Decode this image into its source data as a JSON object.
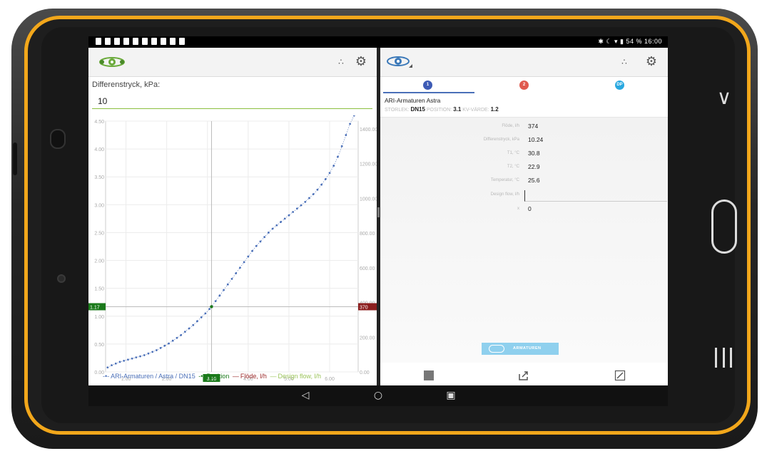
{
  "status_bar": {
    "right_text": "✱ ☾ ▾ ▮ 54 % 16:00"
  },
  "left_pane": {
    "field_label": "Differenstryck, kPa:",
    "field_value": "10",
    "legend": [
      {
        "label": "ARI-Armaturen / Astra / DN15",
        "color": "#4a6fb8"
      },
      {
        "label": "Position",
        "color": "#1b7a1b"
      },
      {
        "label": "Flöde, l/h",
        "color": "#9b2a2a"
      },
      {
        "label": "Design flow, l/h",
        "color": "#9bc45a"
      }
    ]
  },
  "chart_data": {
    "type": "line",
    "x_ticks": [
      "1.00",
      "2.00",
      "3.00",
      "4.00",
      "5.00",
      "6.00"
    ],
    "y_left_ticks": [
      "0.00",
      "0.50",
      "1.00",
      "1.50",
      "2.00",
      "2.50",
      "3.00",
      "3.50",
      "4.00",
      "4.50"
    ],
    "y_right_ticks": [
      "0.00",
      "200.00",
      "400.00",
      "600.00",
      "800.00",
      "1000.00",
      "1200.00",
      "1400.00"
    ],
    "xlim": [
      0.5,
      6.7
    ],
    "ylim_left": [
      0,
      4.5
    ],
    "ylim_right": [
      0,
      1445
    ],
    "grid": true,
    "position_marker": {
      "x_label": "3.10",
      "y_left_label": "1.17",
      "y_right_label": "370",
      "x": 3.1,
      "y": 1.17
    },
    "series": [
      {
        "name": "ARI-Armaturen / Astra / DN15",
        "x": [
          0.55,
          0.65,
          0.75,
          0.85,
          0.95,
          1.05,
          1.15,
          1.25,
          1.35,
          1.45,
          1.55,
          1.65,
          1.75,
          1.85,
          1.95,
          2.05,
          2.15,
          2.25,
          2.35,
          2.45,
          2.55,
          2.65,
          2.75,
          2.85,
          2.95,
          3.05,
          3.1,
          3.2,
          3.3,
          3.4,
          3.5,
          3.6,
          3.7,
          3.8,
          3.9,
          4.0,
          4.1,
          4.2,
          4.3,
          4.4,
          4.5,
          4.6,
          4.7,
          4.8,
          4.9,
          5.0,
          5.1,
          5.2,
          5.3,
          5.4,
          5.5,
          5.6,
          5.7,
          5.8,
          5.9,
          6.0,
          6.1,
          6.2,
          6.3,
          6.4,
          6.5,
          6.6
        ],
        "y": [
          0.08,
          0.12,
          0.15,
          0.18,
          0.2,
          0.22,
          0.24,
          0.26,
          0.28,
          0.3,
          0.33,
          0.36,
          0.39,
          0.43,
          0.47,
          0.51,
          0.56,
          0.61,
          0.66,
          0.72,
          0.78,
          0.84,
          0.91,
          0.98,
          1.05,
          1.13,
          1.17,
          1.27,
          1.37,
          1.47,
          1.57,
          1.67,
          1.77,
          1.87,
          1.97,
          2.07,
          2.17,
          2.26,
          2.34,
          2.42,
          2.5,
          2.57,
          2.63,
          2.69,
          2.75,
          2.81,
          2.87,
          2.93,
          2.99,
          3.05,
          3.12,
          3.19,
          3.27,
          3.36,
          3.46,
          3.57,
          3.7,
          3.86,
          4.05,
          4.25,
          4.45,
          4.6
        ]
      }
    ]
  },
  "right_pane": {
    "tabs": [
      {
        "label": "1",
        "color": "#3d5bb5"
      },
      {
        "label": "2",
        "color": "#e05a4e"
      },
      {
        "label": "DP",
        "color": "#29a8e0"
      }
    ],
    "product_name": "ARI-Armaturen Astra",
    "storlek_label": "STORLEK:",
    "storlek_value": "DN15",
    "position_label": "POSITION:",
    "position_value": "3.1",
    "kv_label": "KV-VÄRDE:",
    "kv_value": "1.2",
    "rows": [
      {
        "label": "Flöde, l/h",
        "value": "374"
      },
      {
        "label": "Differenstryck, kPa",
        "value": "10.24"
      },
      {
        "label": "T1, °C",
        "value": "30.8"
      },
      {
        "label": "T2, °C",
        "value": "22.9"
      },
      {
        "label": "Temperatur, °C",
        "value": "25.6"
      },
      {
        "label": "Design flow, l/h",
        "value": ""
      },
      {
        "label": "x",
        "value": "0"
      }
    ],
    "brand_text": "ARMATUREN"
  }
}
